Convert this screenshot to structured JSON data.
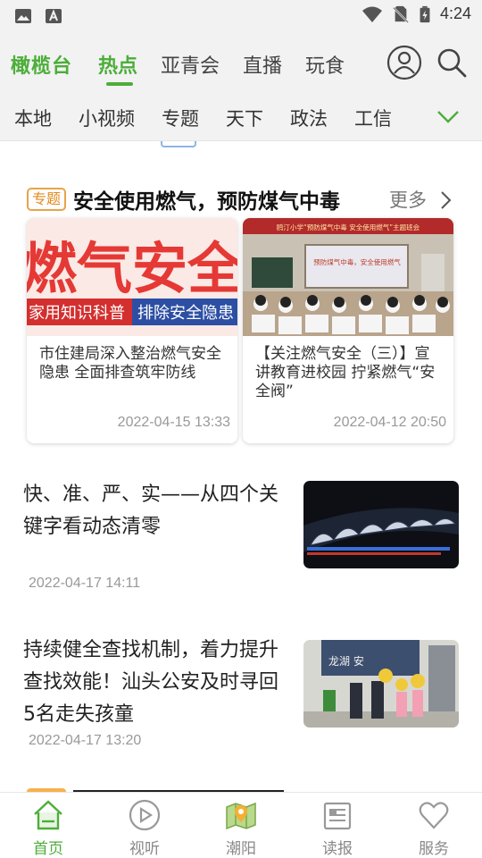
{
  "status_bar": {
    "time": "4:24",
    "icons": [
      "image-icon",
      "font-icon",
      "wifi-icon",
      "no-sim-icon",
      "battery-charging-icon"
    ]
  },
  "header": {
    "brand": "橄榄台",
    "tabs": [
      {
        "label": "热点",
        "active": true
      },
      {
        "label": "亚青会",
        "active": false
      },
      {
        "label": "直播",
        "active": false
      },
      {
        "label": "玩食",
        "active": false
      }
    ],
    "icons": [
      "user-avatar-icon",
      "search-icon"
    ]
  },
  "subnav": {
    "items": [
      "本地",
      "小视频",
      "专题",
      "天下",
      "政法",
      "工信"
    ],
    "expand_icon": "chevron-down-icon"
  },
  "topic": {
    "badge": "专题",
    "title": "安全使用燃气，预防煤气中毒",
    "more": "更多",
    "cards": [
      {
        "title": "市住建局深入整治燃气安全隐患 全面排查筑牢防线",
        "date": "2022-04-15 13:33",
        "image": {
          "big_text": "燃气安全",
          "band_left": "家用知识科普",
          "band_right": "排除安全隐患"
        }
      },
      {
        "title": "【关注燃气安全（三）】宣讲教育进校园 拧紧燃气“安全阀”",
        "date": "2022-04-12 20:50",
        "image": {
          "banner": "鸥汀小学“预防煤气中毒 安全使用燃气”主题班会",
          "screen": "预防煤气中毒，安全使用燃气"
        }
      }
    ]
  },
  "news": [
    {
      "title": "快、准、严、实——从四个关键字看动态清零",
      "date": "2022-04-17 14:11"
    },
    {
      "title": "持续健全查找机制，着力提升查找效能！汕头公安及时寻回5名走失孩童",
      "date": "2022-04-17 13:20",
      "image_sign": "龙湖  安"
    }
  ],
  "bottom_nav": [
    {
      "label": "首页",
      "icon": "home-icon",
      "active": true
    },
    {
      "label": "视听",
      "icon": "play-circle-icon",
      "active": false
    },
    {
      "label": "潮阳",
      "icon": "map-icon",
      "active": false
    },
    {
      "label": "读报",
      "icon": "newspaper-icon",
      "active": false
    },
    {
      "label": "服务",
      "icon": "heart-icon",
      "active": false
    }
  ],
  "colors": {
    "accent": "#4cae39",
    "badge": "#e38a1c",
    "muted": "#999999"
  }
}
